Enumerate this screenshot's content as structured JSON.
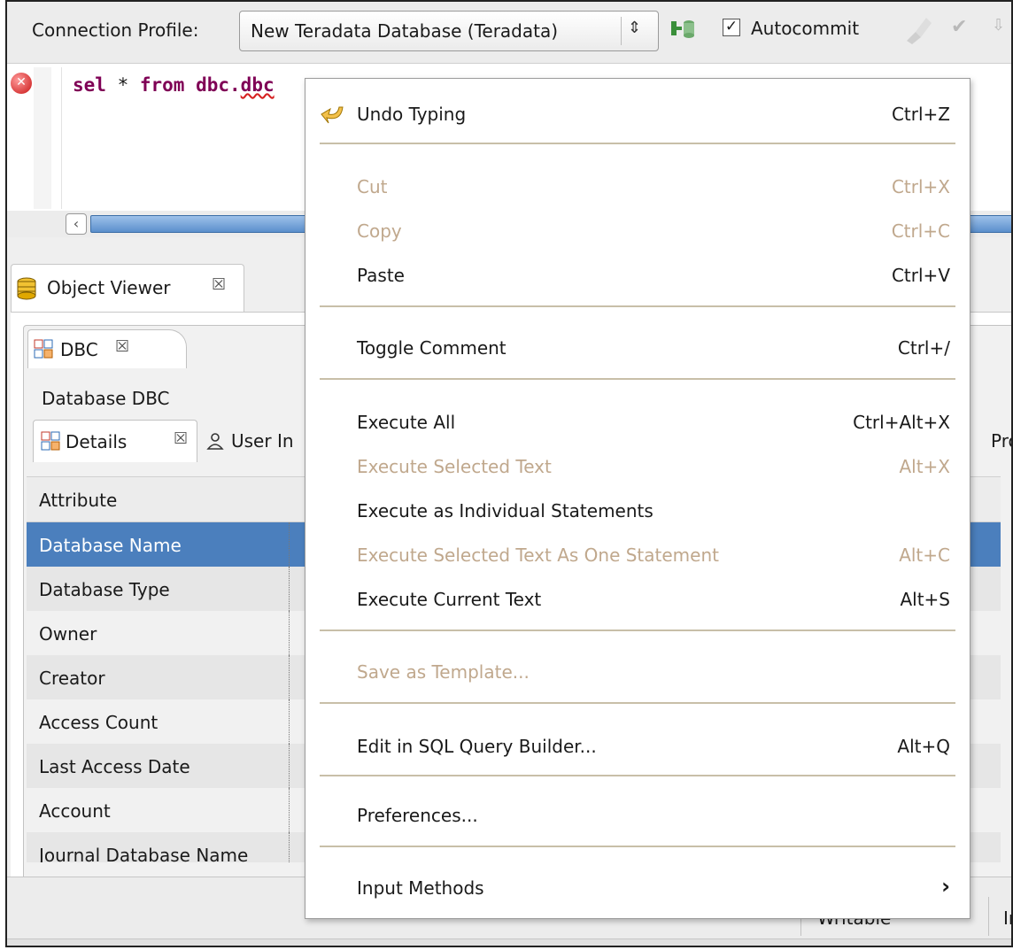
{
  "toolbar": {
    "connection_profile_label": "Connection Profile:",
    "connection_profile_value": "New Teradata Database (Teradata)",
    "autocommit_label": "Autocommit",
    "autocommit_checked": "✓"
  },
  "editor": {
    "sql_kw1": "sel",
    "sql_mid": " * ",
    "sql_kw2": "from",
    "sql_rest": " dbc.",
    "sql_err": "dbc"
  },
  "object_viewer": {
    "tab_label": "Object Viewer",
    "close_glyph": "☒",
    "dbc_tab_label": "DBC",
    "database_title": "Database DBC",
    "details_tab_label": "Details",
    "user_tab_label": "User In",
    "proc_tab_label": "Proc",
    "grid_header": "Attribute",
    "rows": [
      "Database Name",
      "Database Type",
      "Owner",
      "Creator",
      "Access Count",
      "Last Access Date",
      "Account",
      "Journal Database Name"
    ]
  },
  "status_bar": {
    "writable": "Writable",
    "insert": "In"
  },
  "context_menu": {
    "items": [
      {
        "label": "Undo Typing",
        "accel": "Ctrl+Z",
        "enabled": true
      },
      {
        "label": "Cut",
        "accel": "Ctrl+X",
        "enabled": false
      },
      {
        "label": "Copy",
        "accel": "Ctrl+C",
        "enabled": false
      },
      {
        "label": "Paste",
        "accel": "Ctrl+V",
        "enabled": true
      },
      {
        "label": "Toggle Comment",
        "accel": "Ctrl+/",
        "enabled": true
      },
      {
        "label": "Execute All",
        "accel": "Ctrl+Alt+X",
        "enabled": true
      },
      {
        "label": "Execute Selected Text",
        "accel": "Alt+X",
        "enabled": false
      },
      {
        "label": "Execute as Individual Statements",
        "accel": "",
        "enabled": true
      },
      {
        "label": "Execute Selected Text As One Statement",
        "accel": "Alt+C",
        "enabled": false
      },
      {
        "label": "Execute Current Text",
        "accel": "Alt+S",
        "enabled": true
      },
      {
        "label": "Save as Template...",
        "accel": "",
        "enabled": false
      },
      {
        "label": "Edit in SQL Query Builder...",
        "accel": "Alt+Q",
        "enabled": true
      },
      {
        "label": "Preferences...",
        "accel": "",
        "enabled": true
      },
      {
        "label": "Input Methods",
        "accel": "",
        "enabled": true,
        "submenu_glyph": "›"
      }
    ]
  },
  "colors": {
    "selection": "#4b7fbd",
    "keyword": "#7f0055",
    "disabled_text": "#c0a88d",
    "error_red": "#c81414"
  }
}
